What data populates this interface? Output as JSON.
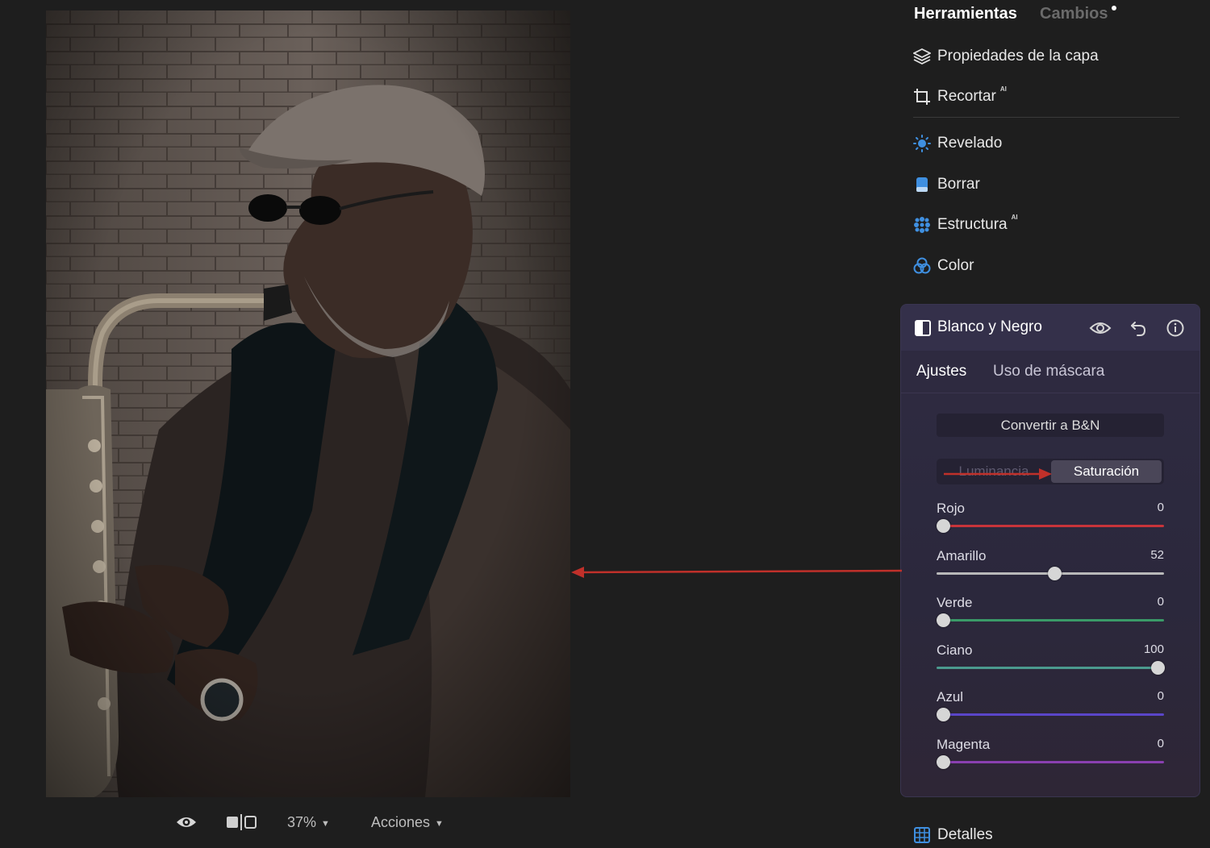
{
  "photo": {
    "alt": ""
  },
  "bottom_toolbar": {
    "zoom": "37%",
    "actions": "Acciones"
  },
  "panel": {
    "tabs": {
      "tools": "Herramientas",
      "changes": "Cambios"
    },
    "tools": [
      {
        "label": "Propiedades de la capa",
        "icon": "layers-icon",
        "ai": false
      },
      {
        "label": "Recortar",
        "icon": "crop-icon",
        "ai": true
      },
      {
        "label": "Revelado",
        "icon": "sun-icon",
        "ai": false
      },
      {
        "label": "Borrar",
        "icon": "eraser-icon",
        "ai": false
      },
      {
        "label": "Estructura",
        "icon": "structure-icon",
        "ai": true
      },
      {
        "label": "Color",
        "icon": "color-circles-icon",
        "ai": false
      }
    ],
    "ai_badge": "AI",
    "accent_color": "#3f8fe0",
    "detail_label": "Detalles"
  },
  "bw": {
    "title": "Blanco y Negro",
    "subtabs": {
      "adjust": "Ajustes",
      "mask": "Uso de máscara"
    },
    "convert": "Convertir a B&N",
    "modes": {
      "luminance": "Luminancia",
      "saturation": "Saturación",
      "active": "saturation"
    },
    "sliders": [
      {
        "label": "Rojo",
        "value": 0,
        "min": 0,
        "max": 100,
        "color": "#c8343a"
      },
      {
        "label": "Amarillo",
        "value": 52,
        "min": 0,
        "max": 100,
        "color": "#b9b9b9"
      },
      {
        "label": "Verde",
        "value": 0,
        "min": 0,
        "max": 100,
        "color": "#3a9a68"
      },
      {
        "label": "Ciano",
        "value": 100,
        "min": 0,
        "max": 100,
        "color": "#4b9a8e"
      },
      {
        "label": "Azul",
        "value": 0,
        "min": 0,
        "max": 100,
        "color": "#5a45c9"
      },
      {
        "label": "Magenta",
        "value": 0,
        "min": 0,
        "max": 100,
        "color": "#8a3fb0"
      }
    ]
  }
}
